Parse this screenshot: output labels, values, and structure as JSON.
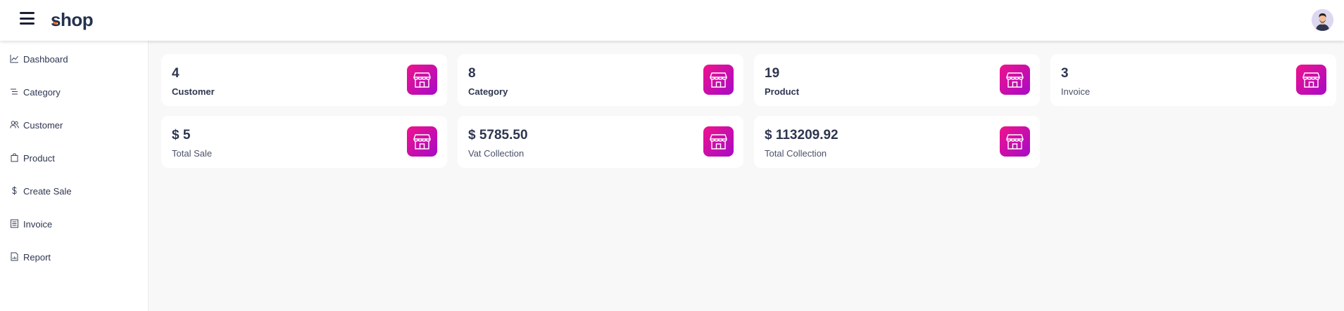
{
  "header": {
    "logo_text": "shop",
    "logo_dot_color": "#f36b21",
    "menu_icon": "hamburger-icon",
    "avatar_icon": "user-avatar"
  },
  "sidebar": {
    "items": [
      {
        "label": "Dashboard",
        "icon": "chart-line-icon"
      },
      {
        "label": "Category",
        "icon": "list-icon"
      },
      {
        "label": "Customer",
        "icon": "users-icon"
      },
      {
        "label": "Product",
        "icon": "bag-icon"
      },
      {
        "label": "Create Sale",
        "icon": "dollar-icon"
      },
      {
        "label": "Invoice",
        "icon": "receipt-icon"
      },
      {
        "label": "Report",
        "icon": "report-icon"
      }
    ]
  },
  "cards": [
    {
      "value": "4",
      "label": "Customer",
      "icon": "store-icon"
    },
    {
      "value": "8",
      "label": "Category",
      "icon": "store-icon"
    },
    {
      "value": "19",
      "label": "Product",
      "icon": "store-icon"
    },
    {
      "value": "3",
      "label": "Invoice",
      "icon": "store-icon"
    },
    {
      "value": "$ 5",
      "label": "Total Sale",
      "icon": "store-icon"
    },
    {
      "value": "$ 5785.50",
      "label": "Vat Collection",
      "icon": "store-icon"
    },
    {
      "value": "$ 113209.92",
      "label": "Total Collection",
      "icon": "store-icon"
    }
  ],
  "colors": {
    "accent_gradient_start": "#f0128c",
    "accent_gradient_end": "#a60bc7",
    "text": "#2e3650",
    "background": "#f8f8f8"
  }
}
